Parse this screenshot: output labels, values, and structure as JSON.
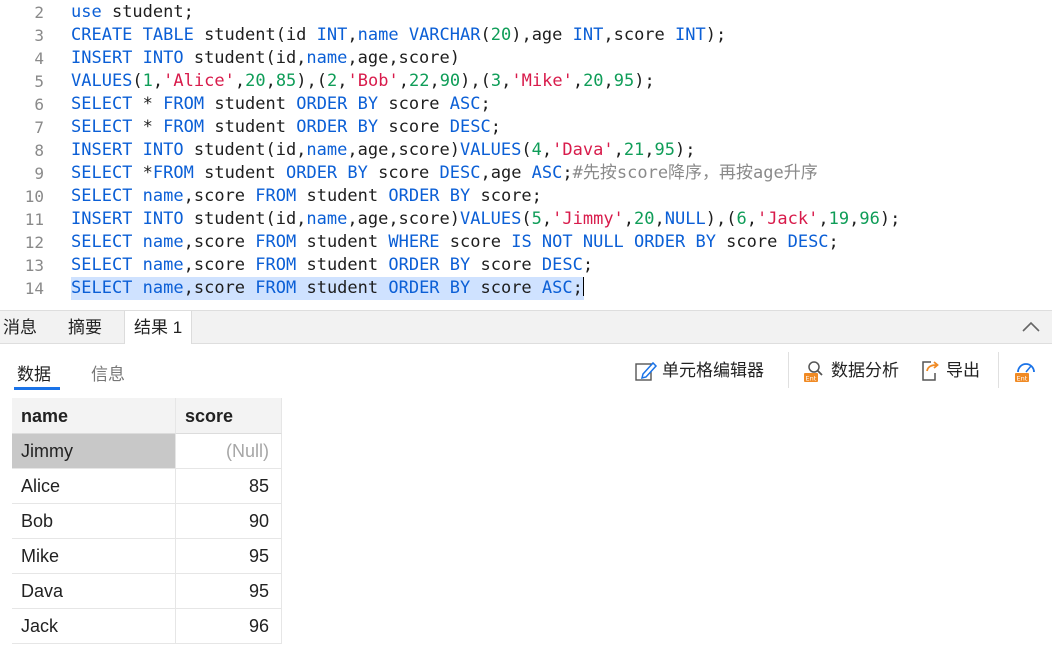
{
  "editor": {
    "lines": [
      {
        "no": "2",
        "tokens": [
          [
            "kw",
            "use"
          ],
          [
            "t",
            " student;"
          ]
        ]
      },
      {
        "no": "3",
        "tokens": [
          [
            "kw",
            "CREATE TABLE"
          ],
          [
            "t",
            " student(id "
          ],
          [
            "kw",
            "INT"
          ],
          [
            "t",
            ","
          ],
          [
            "kw",
            "name"
          ],
          [
            "t",
            " "
          ],
          [
            "kw",
            "VARCHAR"
          ],
          [
            "t",
            "("
          ],
          [
            "num",
            "20"
          ],
          [
            "t",
            "),age "
          ],
          [
            "kw",
            "INT"
          ],
          [
            "t",
            ",score "
          ],
          [
            "kw",
            "INT"
          ],
          [
            "t",
            ");"
          ]
        ]
      },
      {
        "no": "4",
        "tokens": [
          [
            "kw",
            "INSERT INTO"
          ],
          [
            "t",
            " student(id,"
          ],
          [
            "kw",
            "name"
          ],
          [
            "t",
            ",age,score)"
          ]
        ]
      },
      {
        "no": "5",
        "tokens": [
          [
            "kw",
            "VALUES"
          ],
          [
            "t",
            "("
          ],
          [
            "num",
            "1"
          ],
          [
            "t",
            ","
          ],
          [
            "str",
            "'Alice'"
          ],
          [
            "t",
            ","
          ],
          [
            "num",
            "20"
          ],
          [
            "t",
            ","
          ],
          [
            "num",
            "85"
          ],
          [
            "t",
            "),("
          ],
          [
            "num",
            "2"
          ],
          [
            "t",
            ","
          ],
          [
            "str",
            "'Bob'"
          ],
          [
            "t",
            ","
          ],
          [
            "num",
            "22"
          ],
          [
            "t",
            ","
          ],
          [
            "num",
            "90"
          ],
          [
            "t",
            "),("
          ],
          [
            "num",
            "3"
          ],
          [
            "t",
            ","
          ],
          [
            "str",
            "'Mike'"
          ],
          [
            "t",
            ","
          ],
          [
            "num",
            "20"
          ],
          [
            "t",
            ","
          ],
          [
            "num",
            "95"
          ],
          [
            "t",
            ");"
          ]
        ]
      },
      {
        "no": "6",
        "tokens": [
          [
            "kw",
            "SELECT"
          ],
          [
            "t",
            " * "
          ],
          [
            "kw",
            "FROM"
          ],
          [
            "t",
            " student "
          ],
          [
            "kw",
            "ORDER BY"
          ],
          [
            "t",
            " score "
          ],
          [
            "kw",
            "ASC"
          ],
          [
            "t",
            ";"
          ]
        ]
      },
      {
        "no": "7",
        "tokens": [
          [
            "kw",
            "SELECT"
          ],
          [
            "t",
            " * "
          ],
          [
            "kw",
            "FROM"
          ],
          [
            "t",
            " student "
          ],
          [
            "kw",
            "ORDER BY"
          ],
          [
            "t",
            " score "
          ],
          [
            "kw",
            "DESC"
          ],
          [
            "t",
            ";"
          ]
        ]
      },
      {
        "no": "8",
        "tokens": [
          [
            "kw",
            "INSERT INTO"
          ],
          [
            "t",
            " student(id,"
          ],
          [
            "kw",
            "name"
          ],
          [
            "t",
            ",age,score)"
          ],
          [
            "kw",
            "VALUES"
          ],
          [
            "t",
            "("
          ],
          [
            "num",
            "4"
          ],
          [
            "t",
            ","
          ],
          [
            "str",
            "'Dava'"
          ],
          [
            "t",
            ","
          ],
          [
            "num",
            "21"
          ],
          [
            "t",
            ","
          ],
          [
            "num",
            "95"
          ],
          [
            "t",
            ");"
          ]
        ]
      },
      {
        "no": "9",
        "tokens": [
          [
            "kw",
            "SELECT"
          ],
          [
            "t",
            " *"
          ],
          [
            "kw",
            "FROM"
          ],
          [
            "t",
            " student "
          ],
          [
            "kw",
            "ORDER BY"
          ],
          [
            "t",
            " score "
          ],
          [
            "kw",
            "DESC"
          ],
          [
            "t",
            ",age "
          ],
          [
            "kw",
            "ASC"
          ],
          [
            "t",
            ";"
          ],
          [
            "cm",
            "#先按score降序，再按age升序"
          ]
        ]
      },
      {
        "no": "10",
        "tokens": [
          [
            "kw",
            "SELECT"
          ],
          [
            "t",
            " "
          ],
          [
            "kw",
            "name"
          ],
          [
            "t",
            ",score "
          ],
          [
            "kw",
            "FROM"
          ],
          [
            "t",
            " student "
          ],
          [
            "kw",
            "ORDER BY"
          ],
          [
            "t",
            " score;"
          ]
        ]
      },
      {
        "no": "11",
        "tokens": [
          [
            "kw",
            "INSERT INTO"
          ],
          [
            "t",
            " student(id,"
          ],
          [
            "kw",
            "name"
          ],
          [
            "t",
            ",age,score)"
          ],
          [
            "kw",
            "VALUES"
          ],
          [
            "t",
            "("
          ],
          [
            "num",
            "5"
          ],
          [
            "t",
            ","
          ],
          [
            "str",
            "'Jimmy'"
          ],
          [
            "t",
            ","
          ],
          [
            "num",
            "20"
          ],
          [
            "t",
            ","
          ],
          [
            "kw",
            "NULL"
          ],
          [
            "t",
            "),("
          ],
          [
            "num",
            "6"
          ],
          [
            "t",
            ","
          ],
          [
            "str",
            "'Jack'"
          ],
          [
            "t",
            ","
          ],
          [
            "num",
            "19"
          ],
          [
            "t",
            ","
          ],
          [
            "num",
            "96"
          ],
          [
            "t",
            ");"
          ]
        ]
      },
      {
        "no": "12",
        "tokens": [
          [
            "kw",
            "SELECT"
          ],
          [
            "t",
            " "
          ],
          [
            "kw",
            "name"
          ],
          [
            "t",
            ",score "
          ],
          [
            "kw",
            "FROM"
          ],
          [
            "t",
            " student "
          ],
          [
            "kw",
            "WHERE"
          ],
          [
            "t",
            " score "
          ],
          [
            "kw",
            "IS NOT NULL"
          ],
          [
            "t",
            " "
          ],
          [
            "kw",
            "ORDER BY"
          ],
          [
            "t",
            " score "
          ],
          [
            "kw",
            "DESC"
          ],
          [
            "t",
            ";"
          ]
        ]
      },
      {
        "no": "13",
        "tokens": [
          [
            "kw",
            "SELECT"
          ],
          [
            "t",
            " "
          ],
          [
            "kw",
            "name"
          ],
          [
            "t",
            ",score "
          ],
          [
            "kw",
            "FROM"
          ],
          [
            "t",
            " student "
          ],
          [
            "kw",
            "ORDER BY"
          ],
          [
            "t",
            " score "
          ],
          [
            "kw",
            "DESC"
          ],
          [
            "t",
            ";"
          ]
        ]
      },
      {
        "no": "14",
        "selected": true,
        "tokens": [
          [
            "kw",
            "SELECT"
          ],
          [
            "t",
            " "
          ],
          [
            "kw",
            "name"
          ],
          [
            "t",
            ",score "
          ],
          [
            "kw",
            "FROM"
          ],
          [
            "t",
            " student "
          ],
          [
            "kw",
            "ORDER BY"
          ],
          [
            "t",
            " score "
          ],
          [
            "kw",
            "ASC"
          ],
          [
            "t",
            ";"
          ]
        ]
      }
    ]
  },
  "result_tabs": {
    "messages": "消息",
    "summary": "摘要",
    "result1": "结果 1"
  },
  "subtabs": {
    "data": "数据",
    "info": "信息"
  },
  "toolbar": {
    "cell_editor": "单元格编辑器",
    "data_analysis": "数据分析",
    "export": "导出"
  },
  "grid": {
    "columns": [
      "name",
      "score"
    ],
    "rows": [
      {
        "name": "Jimmy",
        "score": "(Null)"
      },
      {
        "name": "Alice",
        "score": "85"
      },
      {
        "name": "Bob",
        "score": "90"
      },
      {
        "name": "Mike",
        "score": "95"
      },
      {
        "name": "Dava",
        "score": "95"
      },
      {
        "name": "Jack",
        "score": "96"
      }
    ]
  },
  "colors": {
    "keyword": "#0b5fd6",
    "string": "#d81b4b",
    "number": "#0f9d58",
    "selection": "#cfe2ff",
    "accent": "#1a73e8"
  }
}
